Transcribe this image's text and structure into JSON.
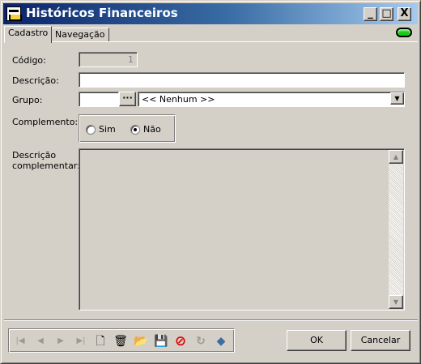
{
  "window": {
    "title": "Históricos Financeiros",
    "controls": {
      "minimize": "_",
      "maximize": "□",
      "close": "X"
    }
  },
  "tabs": [
    {
      "label": "Cadastro",
      "active": true
    },
    {
      "label": "Navegação",
      "active": false
    }
  ],
  "status_indicator": {
    "color": "#18c818"
  },
  "form": {
    "codigo": {
      "label": "Código:",
      "value": "1"
    },
    "descricao": {
      "label": "Descrição:",
      "value": ""
    },
    "grupo": {
      "label": "Grupo:",
      "code_value": "",
      "lookup_button": "···",
      "selected": "<< Nenhum >>"
    },
    "complemento": {
      "label": "Complemento:",
      "options": [
        {
          "label": "Sim",
          "checked": false
        },
        {
          "label": "Não",
          "checked": true
        }
      ]
    },
    "descricao_complementar": {
      "label_line1": "Descrição",
      "label_line2": "complementar:",
      "value": ""
    }
  },
  "navigator": {
    "buttons": [
      {
        "name": "first",
        "glyph": "|◀",
        "enabled": false
      },
      {
        "name": "prior",
        "glyph": "◀",
        "enabled": false
      },
      {
        "name": "next",
        "glyph": "▶",
        "enabled": false
      },
      {
        "name": "last",
        "glyph": "▶|",
        "enabled": false
      },
      {
        "name": "new",
        "glyph": "🗋",
        "enabled": true
      },
      {
        "name": "delete",
        "glyph": "🗑",
        "enabled": true
      },
      {
        "name": "open",
        "glyph": "📂",
        "enabled": true
      },
      {
        "name": "save",
        "glyph": "💾",
        "enabled": true
      },
      {
        "name": "cancel",
        "glyph": "⊘",
        "enabled": true,
        "color": "#e00000"
      },
      {
        "name": "refresh",
        "glyph": "↻",
        "enabled": false
      },
      {
        "name": "search",
        "glyph": "◆",
        "enabled": true
      }
    ]
  },
  "footer": {
    "ok_label": "OK",
    "cancel_label": "Cancelar"
  }
}
